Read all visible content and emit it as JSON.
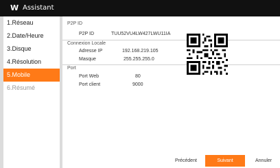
{
  "window": {
    "logo": "W",
    "title": "Assistant"
  },
  "sidebar": {
    "items": [
      {
        "label": "1.Réseau"
      },
      {
        "label": "2.Date/Heure"
      },
      {
        "label": "3.Disque"
      },
      {
        "label": "4.Résolution"
      },
      {
        "label": "5.Mobile"
      },
      {
        "label": "6.Résumé"
      }
    ]
  },
  "p2p": {
    "section": "P2P ID",
    "id_label": "P2P ID",
    "id_value": "TUU52VU4LW427LWU11IA"
  },
  "local": {
    "section": "Connexion Locale",
    "ip_label": "Adresse IP",
    "ip_value": "192.168.219.105",
    "mask_label": "Masque",
    "mask_value": "255.255.255.0"
  },
  "port": {
    "section": "Port",
    "web_label": "Port Web",
    "web_value": "80",
    "client_label": "Port client",
    "client_value": "9000"
  },
  "footer": {
    "prev": "Précédent",
    "next": "Suivant",
    "cancel": "Annuler"
  },
  "colors": {
    "accent": "#ff7a17",
    "titlebar": "#111111"
  }
}
